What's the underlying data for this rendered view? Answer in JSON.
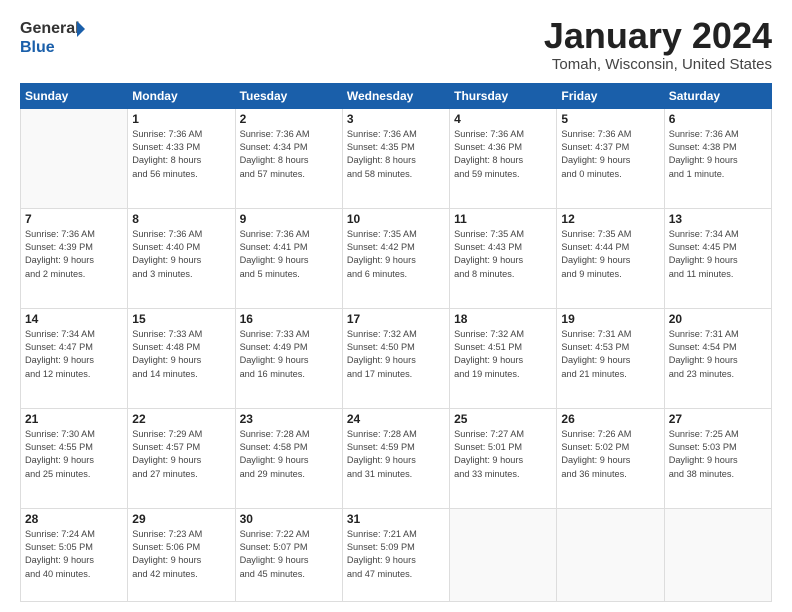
{
  "logo": {
    "line1": "General",
    "line2": "Blue",
    "icon": "▶"
  },
  "header": {
    "month": "January 2024",
    "location": "Tomah, Wisconsin, United States"
  },
  "days_of_week": [
    "Sunday",
    "Monday",
    "Tuesday",
    "Wednesday",
    "Thursday",
    "Friday",
    "Saturday"
  ],
  "weeks": [
    [
      {
        "day": "",
        "info": ""
      },
      {
        "day": "1",
        "info": "Sunrise: 7:36 AM\nSunset: 4:33 PM\nDaylight: 8 hours\nand 56 minutes."
      },
      {
        "day": "2",
        "info": "Sunrise: 7:36 AM\nSunset: 4:34 PM\nDaylight: 8 hours\nand 57 minutes."
      },
      {
        "day": "3",
        "info": "Sunrise: 7:36 AM\nSunset: 4:35 PM\nDaylight: 8 hours\nand 58 minutes."
      },
      {
        "day": "4",
        "info": "Sunrise: 7:36 AM\nSunset: 4:36 PM\nDaylight: 8 hours\nand 59 minutes."
      },
      {
        "day": "5",
        "info": "Sunrise: 7:36 AM\nSunset: 4:37 PM\nDaylight: 9 hours\nand 0 minutes."
      },
      {
        "day": "6",
        "info": "Sunrise: 7:36 AM\nSunset: 4:38 PM\nDaylight: 9 hours\nand 1 minute."
      }
    ],
    [
      {
        "day": "7",
        "info": "Sunrise: 7:36 AM\nSunset: 4:39 PM\nDaylight: 9 hours\nand 2 minutes."
      },
      {
        "day": "8",
        "info": "Sunrise: 7:36 AM\nSunset: 4:40 PM\nDaylight: 9 hours\nand 3 minutes."
      },
      {
        "day": "9",
        "info": "Sunrise: 7:36 AM\nSunset: 4:41 PM\nDaylight: 9 hours\nand 5 minutes."
      },
      {
        "day": "10",
        "info": "Sunrise: 7:35 AM\nSunset: 4:42 PM\nDaylight: 9 hours\nand 6 minutes."
      },
      {
        "day": "11",
        "info": "Sunrise: 7:35 AM\nSunset: 4:43 PM\nDaylight: 9 hours\nand 8 minutes."
      },
      {
        "day": "12",
        "info": "Sunrise: 7:35 AM\nSunset: 4:44 PM\nDaylight: 9 hours\nand 9 minutes."
      },
      {
        "day": "13",
        "info": "Sunrise: 7:34 AM\nSunset: 4:45 PM\nDaylight: 9 hours\nand 11 minutes."
      }
    ],
    [
      {
        "day": "14",
        "info": "Sunrise: 7:34 AM\nSunset: 4:47 PM\nDaylight: 9 hours\nand 12 minutes."
      },
      {
        "day": "15",
        "info": "Sunrise: 7:33 AM\nSunset: 4:48 PM\nDaylight: 9 hours\nand 14 minutes."
      },
      {
        "day": "16",
        "info": "Sunrise: 7:33 AM\nSunset: 4:49 PM\nDaylight: 9 hours\nand 16 minutes."
      },
      {
        "day": "17",
        "info": "Sunrise: 7:32 AM\nSunset: 4:50 PM\nDaylight: 9 hours\nand 17 minutes."
      },
      {
        "day": "18",
        "info": "Sunrise: 7:32 AM\nSunset: 4:51 PM\nDaylight: 9 hours\nand 19 minutes."
      },
      {
        "day": "19",
        "info": "Sunrise: 7:31 AM\nSunset: 4:53 PM\nDaylight: 9 hours\nand 21 minutes."
      },
      {
        "day": "20",
        "info": "Sunrise: 7:31 AM\nSunset: 4:54 PM\nDaylight: 9 hours\nand 23 minutes."
      }
    ],
    [
      {
        "day": "21",
        "info": "Sunrise: 7:30 AM\nSunset: 4:55 PM\nDaylight: 9 hours\nand 25 minutes."
      },
      {
        "day": "22",
        "info": "Sunrise: 7:29 AM\nSunset: 4:57 PM\nDaylight: 9 hours\nand 27 minutes."
      },
      {
        "day": "23",
        "info": "Sunrise: 7:28 AM\nSunset: 4:58 PM\nDaylight: 9 hours\nand 29 minutes."
      },
      {
        "day": "24",
        "info": "Sunrise: 7:28 AM\nSunset: 4:59 PM\nDaylight: 9 hours\nand 31 minutes."
      },
      {
        "day": "25",
        "info": "Sunrise: 7:27 AM\nSunset: 5:01 PM\nDaylight: 9 hours\nand 33 minutes."
      },
      {
        "day": "26",
        "info": "Sunrise: 7:26 AM\nSunset: 5:02 PM\nDaylight: 9 hours\nand 36 minutes."
      },
      {
        "day": "27",
        "info": "Sunrise: 7:25 AM\nSunset: 5:03 PM\nDaylight: 9 hours\nand 38 minutes."
      }
    ],
    [
      {
        "day": "28",
        "info": "Sunrise: 7:24 AM\nSunset: 5:05 PM\nDaylight: 9 hours\nand 40 minutes."
      },
      {
        "day": "29",
        "info": "Sunrise: 7:23 AM\nSunset: 5:06 PM\nDaylight: 9 hours\nand 42 minutes."
      },
      {
        "day": "30",
        "info": "Sunrise: 7:22 AM\nSunset: 5:07 PM\nDaylight: 9 hours\nand 45 minutes."
      },
      {
        "day": "31",
        "info": "Sunrise: 7:21 AM\nSunset: 5:09 PM\nDaylight: 9 hours\nand 47 minutes."
      },
      {
        "day": "",
        "info": ""
      },
      {
        "day": "",
        "info": ""
      },
      {
        "day": "",
        "info": ""
      }
    ]
  ]
}
